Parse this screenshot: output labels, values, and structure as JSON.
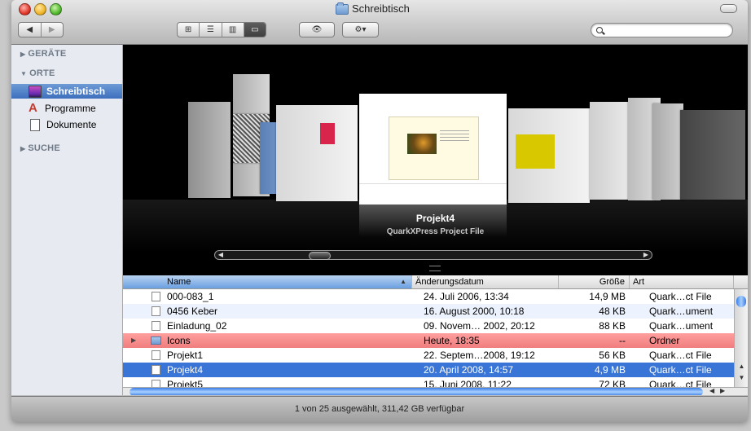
{
  "window": {
    "title": "Schreibtisch"
  },
  "toolbar": {
    "back_icon": "back-arrow-icon",
    "forward_icon": "forward-arrow-icon",
    "view_icons_label": "⊞",
    "view_list_label": "☰",
    "view_columns_label": "▥",
    "view_coverflow_label": "▭",
    "quicklook_label": "👁",
    "action_label": "⚙▾",
    "search_placeholder": ""
  },
  "sidebar": {
    "sections": [
      {
        "label": "GERÄTE",
        "collapsed": true
      },
      {
        "label": "ORTE",
        "collapsed": false
      },
      {
        "label": "SUCHE",
        "collapsed": true
      }
    ],
    "items": [
      {
        "label": "Schreibtisch",
        "selected": true,
        "icon": "desktop-icon"
      },
      {
        "label": "Programme",
        "selected": false,
        "icon": "applications-icon"
      },
      {
        "label": "Dokumente",
        "selected": false,
        "icon": "documents-icon"
      }
    ]
  },
  "coverflow": {
    "current_title": "Projekt4",
    "current_subtitle": "QuarkXPress Project File",
    "split_handle": "═"
  },
  "list": {
    "columns": {
      "name": "Name",
      "date": "Änderungsdatum",
      "size": "Größe",
      "kind": "Art"
    },
    "sort_indicator": "▲",
    "rows": [
      {
        "name": "000-083_1",
        "date": "24. Juli 2006, 13:34",
        "size": "14,9 MB",
        "kind": "Quark…ct File",
        "state": "normal"
      },
      {
        "name": "0456 Keber",
        "date": "16. August 2000, 10:18",
        "size": "48 KB",
        "kind": "Quark…ument",
        "state": "alt"
      },
      {
        "name": "Einladung_02",
        "date": "09. Novem… 2002, 20:12",
        "size": "88 KB",
        "kind": "Quark…ument",
        "state": "normal"
      },
      {
        "name": "Icons",
        "date": "Heute, 18:35",
        "size": "--",
        "kind": "Ordner",
        "state": "folder"
      },
      {
        "name": "Projekt1",
        "date": "22. Septem…2008, 19:12",
        "size": "56 KB",
        "kind": "Quark…ct File",
        "state": "normal"
      },
      {
        "name": "Projekt4",
        "date": "20. April 2008, 14:57",
        "size": "4,9 MB",
        "kind": "Quark…ct File",
        "state": "selected"
      },
      {
        "name": "Projekt5",
        "date": "15. Juni 2008, 11:22",
        "size": "72 KB",
        "kind": "Quark…ct File",
        "state": "normal"
      }
    ]
  },
  "status": {
    "text": "1 von 25 ausgewählt, 311,42 GB verfügbar"
  },
  "colors": {
    "selection": "#3875d7",
    "folder_label": "#f07e7e",
    "sidebar_selection": "#3d6fbd"
  }
}
